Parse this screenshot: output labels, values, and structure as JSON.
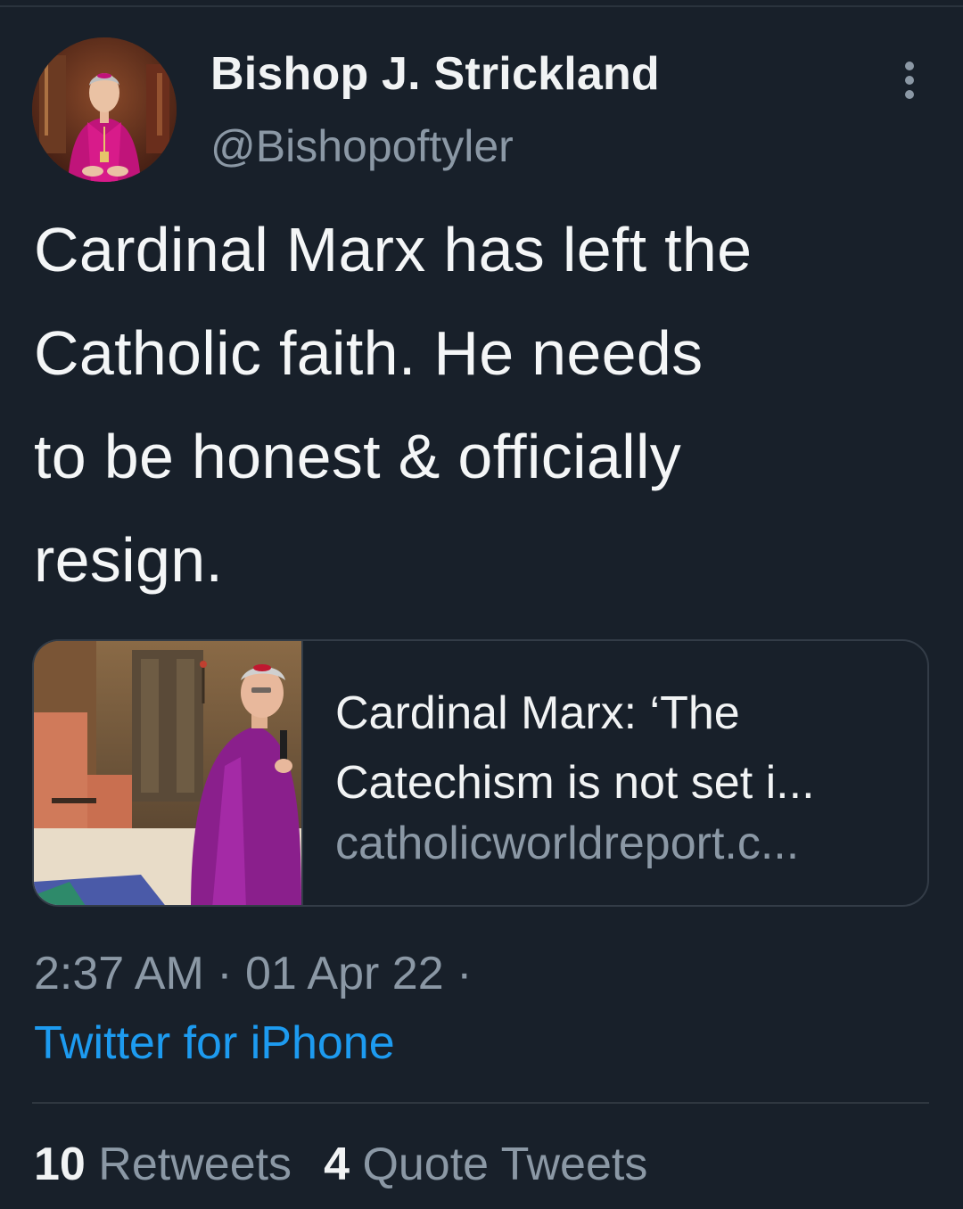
{
  "theme": {
    "background": "#18202a",
    "text_primary": "#f1f3f4",
    "text_secondary": "#8b98a5",
    "accent": "#1d9bf0",
    "divider": "#2f3740"
  },
  "tweet": {
    "author": {
      "display_name": "Bishop J. Strickland",
      "handle": "@Bishopoftyler",
      "avatar_icon": "profile-photo"
    },
    "more_icon": "vertical-ellipsis-icon",
    "text_lines": [
      "Cardinal Marx has left the",
      "Catholic faith. He needs",
      "to be honest & officially",
      "resign."
    ],
    "link_card": {
      "thumbnail": "cardinal-in-purple-vestments-photo",
      "title_lines": [
        "Cardinal Marx: ‘The",
        "Catechism is not set i..."
      ],
      "domain": "catholicworldreport.c..."
    },
    "timestamp": "2:37 AM · 01 Apr 22 ·",
    "source": "Twitter for iPhone",
    "stats": {
      "retweets_count": "10",
      "retweets_label": "Retweets",
      "quotes_count": "4",
      "quotes_label": "Quote Tweets"
    }
  }
}
